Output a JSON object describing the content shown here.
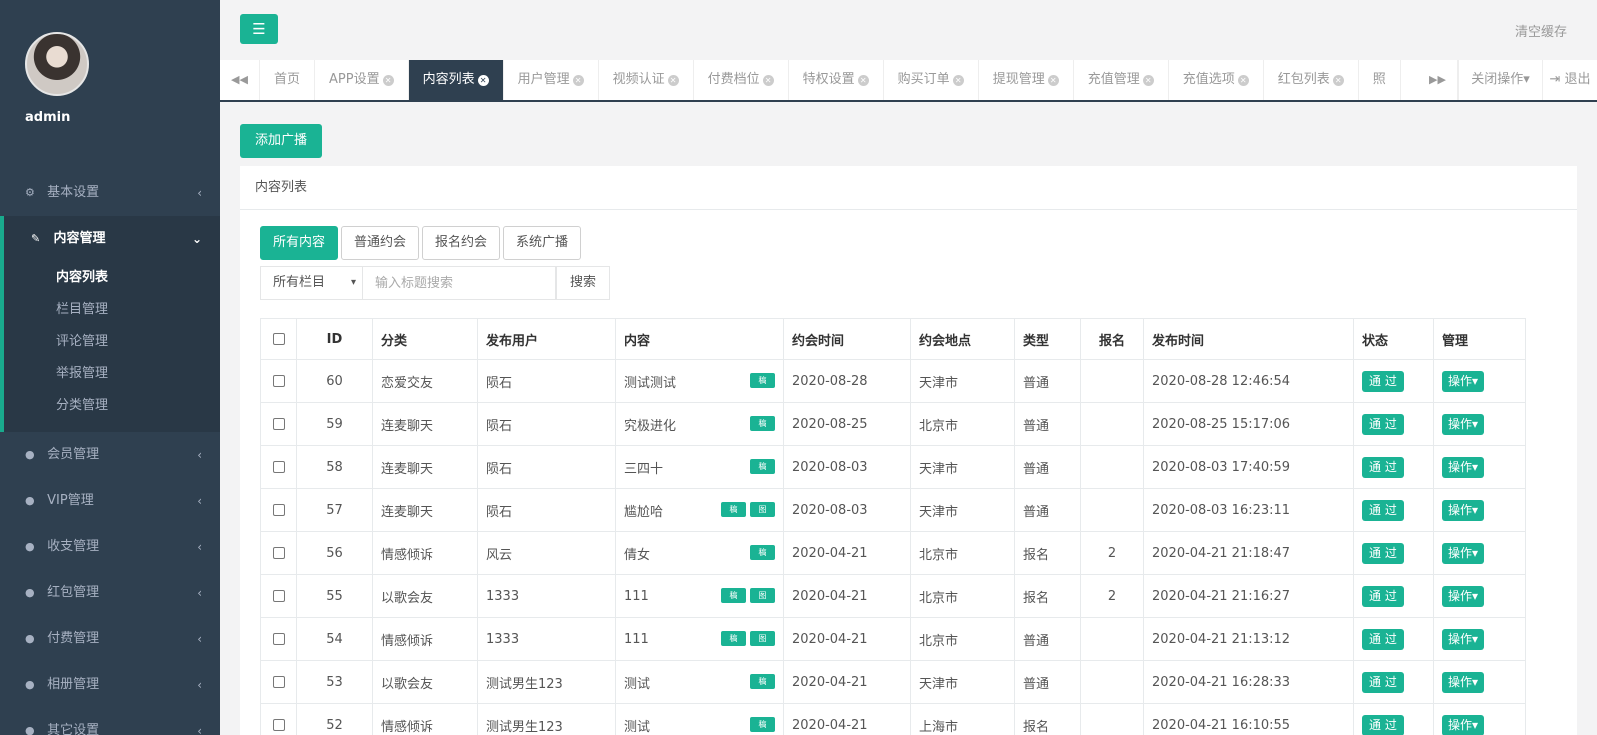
{
  "sidebar": {
    "admin_name": "admin",
    "items": [
      {
        "label": "基本设置",
        "icon": "gear-icon",
        "glyph": "⚙"
      },
      {
        "label": "内容管理",
        "icon": "edit-icon",
        "glyph": "✎"
      },
      {
        "label": "会员管理",
        "icon": "user-icon",
        "glyph": "●"
      },
      {
        "label": "VIP管理",
        "icon": "user-icon",
        "glyph": "●"
      },
      {
        "label": "收支管理",
        "icon": "user-icon",
        "glyph": "●"
      },
      {
        "label": "红包管理",
        "icon": "user-icon",
        "glyph": "●"
      },
      {
        "label": "付费管理",
        "icon": "user-icon",
        "glyph": "●"
      },
      {
        "label": "相册管理",
        "icon": "user-icon",
        "glyph": "●"
      },
      {
        "label": "其它设置",
        "icon": "user-icon",
        "glyph": "●"
      }
    ],
    "submenu": [
      "内容列表",
      "栏目管理",
      "评论管理",
      "举报管理",
      "分类管理"
    ]
  },
  "topbar": {
    "menu_glyph": "☰",
    "clear_cache": "清空缓存"
  },
  "tabs": {
    "prev_glyph": "◀◀",
    "next_glyph": "▶▶",
    "items": [
      "首页",
      "APP设置",
      "内容列表",
      "用户管理",
      "视频认证",
      "付费档位",
      "特权设置",
      "购买订单",
      "提现管理",
      "充值管理",
      "充值选项",
      "红包列表",
      "照"
    ],
    "close_ops": "关闭操作▾",
    "logout": "⇥ 退出"
  },
  "toolbar": {
    "add_label": "添加广播"
  },
  "panel": {
    "title": "内容列表"
  },
  "filters": [
    "所有内容",
    "普通约会",
    "报名约会",
    "系统广播"
  ],
  "search": {
    "select_value": "所有栏目",
    "placeholder": "输入标题搜索",
    "button": "搜索"
  },
  "table": {
    "headers": [
      "ID",
      "分类",
      "发布用户",
      "内容",
      "约会时间",
      "约会地点",
      "类型",
      "报名",
      "发布时间",
      "状态",
      "管理"
    ],
    "badge_label": "稿",
    "badge2_label": "图",
    "status_label": "通 过",
    "ops_label": "操作▾",
    "rows": [
      {
        "id": "60",
        "category": "恋爱交友",
        "user": "陨石",
        "content": "测试测试",
        "badges": 1,
        "date": "2020-08-28",
        "place": "天津市",
        "type": "普通",
        "signup": "",
        "published": "2020-08-28 12:46:54"
      },
      {
        "id": "59",
        "category": "连麦聊天",
        "user": "陨石",
        "content": "究极进化",
        "badges": 1,
        "date": "2020-08-25",
        "place": "北京市",
        "type": "普通",
        "signup": "",
        "published": "2020-08-25 15:17:06"
      },
      {
        "id": "58",
        "category": "连麦聊天",
        "user": "陨石",
        "content": "三四十",
        "badges": 1,
        "date": "2020-08-03",
        "place": "天津市",
        "type": "普通",
        "signup": "",
        "published": "2020-08-03 17:40:59"
      },
      {
        "id": "57",
        "category": "连麦聊天",
        "user": "陨石",
        "content": "尴尬哈",
        "badges": 2,
        "date": "2020-08-03",
        "place": "天津市",
        "type": "普通",
        "signup": "",
        "published": "2020-08-03 16:23:11"
      },
      {
        "id": "56",
        "category": "情感倾诉",
        "user": "风云",
        "content": "倩女",
        "badges": 1,
        "date": "2020-04-21",
        "place": "北京市",
        "type": "报名",
        "signup": "2",
        "published": "2020-04-21 21:18:47"
      },
      {
        "id": "55",
        "category": "以歌会友",
        "user": "1333",
        "content": "111",
        "badges": 2,
        "date": "2020-04-21",
        "place": "北京市",
        "type": "报名",
        "signup": "2",
        "published": "2020-04-21 21:16:27"
      },
      {
        "id": "54",
        "category": "情感倾诉",
        "user": "1333",
        "content": "111",
        "badges": 2,
        "date": "2020-04-21",
        "place": "北京市",
        "type": "普通",
        "signup": "",
        "published": "2020-04-21 21:13:12"
      },
      {
        "id": "53",
        "category": "以歌会友",
        "user": "测试男生123",
        "content": "测试",
        "badges": 1,
        "date": "2020-04-21",
        "place": "天津市",
        "type": "普通",
        "signup": "",
        "published": "2020-04-21 16:28:33"
      },
      {
        "id": "52",
        "category": "情感倾诉",
        "user": "测试男生123",
        "content": "测试",
        "badges": 1,
        "date": "2020-04-21",
        "place": "上海市",
        "type": "报名",
        "signup": "",
        "published": "2020-04-21 16:10:55"
      }
    ]
  },
  "colors": {
    "accent": "#1ab394",
    "sidebar_bg": "#2f4050",
    "sidebar_active_bg": "#293846"
  }
}
